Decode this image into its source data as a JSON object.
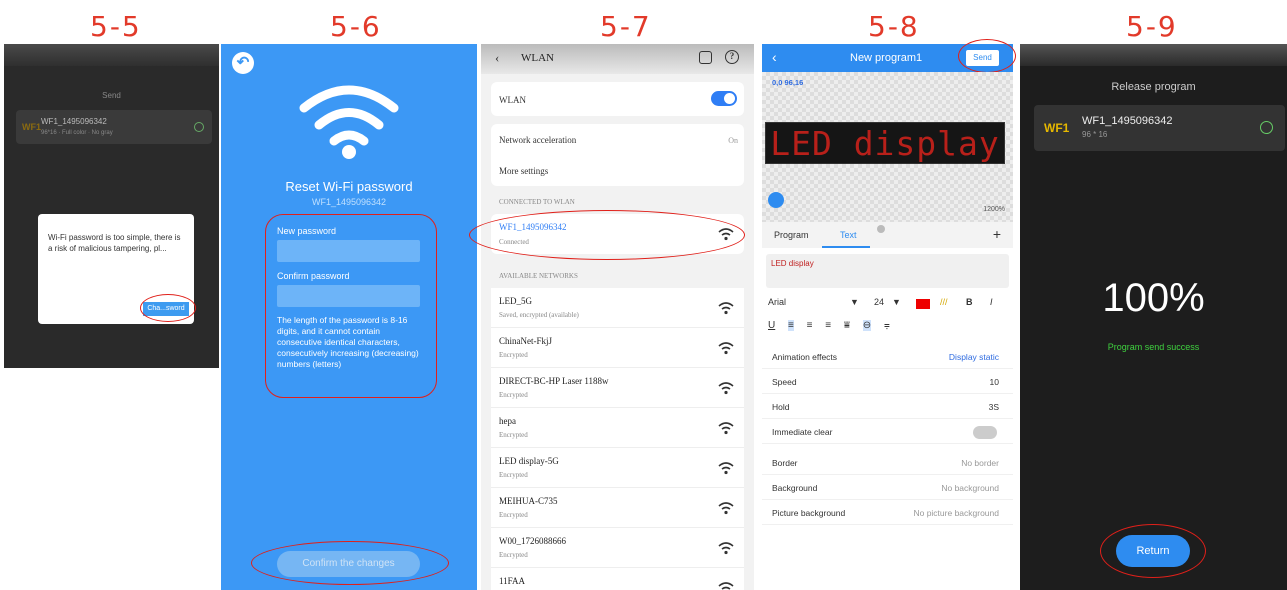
{
  "steps": [
    "5-5",
    "5-6",
    "5-7",
    "5-8",
    "5-9"
  ],
  "p1": {
    "title": "Send",
    "device": {
      "badge": "WF1",
      "name": "WF1_1495096342",
      "spec": "96*16 · Full color · No gray"
    },
    "dialog": {
      "message": "Wi-Fi password is too simple, there is a risk of malicious tampering, pl...",
      "button": "Cha...sword"
    }
  },
  "p2": {
    "title": "Reset Wi-Fi password",
    "device": "WF1_1495096342",
    "new_label": "New password",
    "confirm_label": "Confirm password",
    "hint": "The length of the password is 8-16 digits, and it cannot contain consecutive identical characters, consecutively increasing (decreasing) numbers (letters)",
    "confirm_button": "Confirm the changes"
  },
  "p3": {
    "title": "WLAN",
    "wlan": "WLAN",
    "accel": "Network acceleration",
    "accel_val": "On",
    "more": "More settings",
    "connected_sec": "CONNECTED TO WLAN",
    "connected": {
      "name": "WF1_1495096342",
      "status": "Connected"
    },
    "avail_sec": "AVAILABLE NETWORKS",
    "networks": [
      {
        "name": "LED_5G",
        "status": "Saved, encrypted (available)"
      },
      {
        "name": "ChinaNet-FkjJ",
        "status": "Encrypted"
      },
      {
        "name": "DIRECT-BC-HP Laser 1188w",
        "status": "Encrypted"
      },
      {
        "name": "hepa",
        "status": "Encrypted"
      },
      {
        "name": "LED display-5G",
        "status": "Encrypted"
      },
      {
        "name": "MEIHUA-C735",
        "status": "Encrypted"
      },
      {
        "name": "W00_1726088666",
        "status": "Encrypted"
      },
      {
        "name": "11FAA",
        "status": ""
      }
    ]
  },
  "p4": {
    "title": "New program1",
    "send": "Send",
    "coord": "0,0 96,16",
    "led_text": "LED display",
    "zoom": "1200%",
    "tab_program": "Program",
    "tab_text": "Text",
    "text_value": "LED display",
    "font": "Arial",
    "size": "24",
    "settings": [
      {
        "label": "Animation effects",
        "value": "Display static"
      },
      {
        "label": "Speed",
        "value": "10"
      },
      {
        "label": "Hold",
        "value": "3S"
      },
      {
        "label": "Immediate clear",
        "value": ""
      },
      {
        "label": "Border",
        "value": "No border"
      },
      {
        "label": "Background",
        "value": "No background"
      },
      {
        "label": "Picture background",
        "value": "No picture background"
      }
    ]
  },
  "p5": {
    "title": "Release program",
    "device": {
      "badge": "WF1",
      "name": "WF1_1495096342",
      "spec": "96 * 16"
    },
    "percent": "100%",
    "status": "Program send success",
    "return": "Return"
  },
  "colors": {
    "accent": "#2e8cf0",
    "annotation": "#e0201a",
    "led": "#b8201a"
  }
}
